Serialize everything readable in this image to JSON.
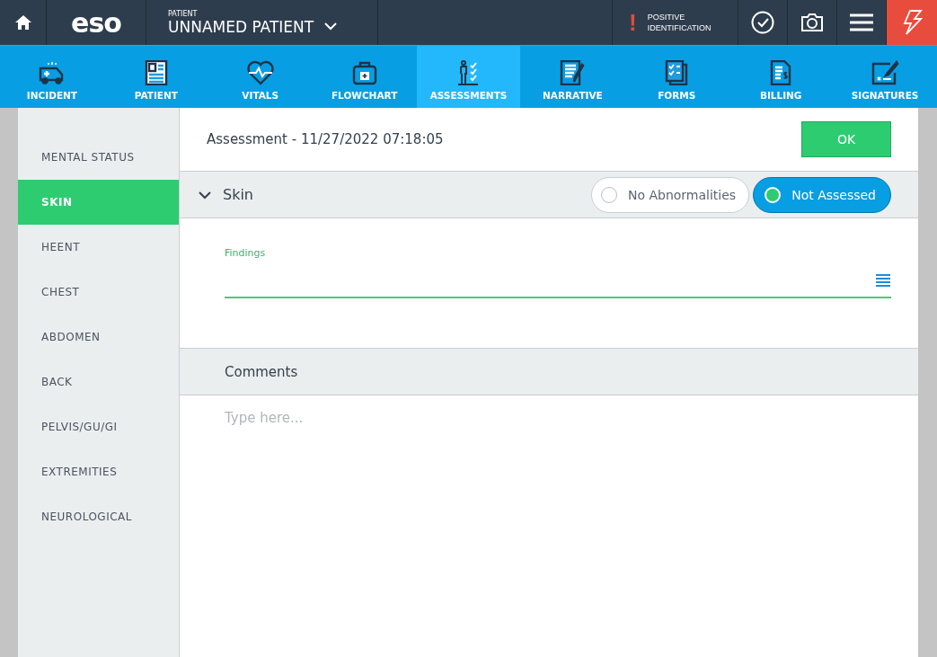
{
  "top_bar": {
    "logo": "eso",
    "patient_label": "PATIENT",
    "patient_name": "UNNAMED PATIENT",
    "alert_mark": "!",
    "alert_text": "POSITIVE IDENTIFICATION"
  },
  "tabs": [
    {
      "label": "INCIDENT",
      "selected": false
    },
    {
      "label": "PATIENT",
      "selected": false
    },
    {
      "label": "VITALS",
      "selected": false
    },
    {
      "label": "FLOWCHART",
      "selected": false
    },
    {
      "label": "ASSESSMENTS",
      "selected": true
    },
    {
      "label": "NARRATIVE",
      "selected": false
    },
    {
      "label": "FORMS",
      "selected": false
    },
    {
      "label": "BILLING",
      "selected": false
    },
    {
      "label": "SIGNATURES",
      "selected": false
    }
  ],
  "sidebar": {
    "items": [
      {
        "label": "MENTAL STATUS",
        "selected": false
      },
      {
        "label": "SKIN",
        "selected": true
      },
      {
        "label": "HEENT",
        "selected": false
      },
      {
        "label": "CHEST",
        "selected": false
      },
      {
        "label": "ABDOMEN",
        "selected": false
      },
      {
        "label": "BACK",
        "selected": false
      },
      {
        "label": "PELVIS/GU/GI",
        "selected": false
      },
      {
        "label": "EXTREMITIES",
        "selected": false
      },
      {
        "label": "NEUROLOGICAL",
        "selected": false
      }
    ]
  },
  "header": {
    "title": "Assessment - 11/27/2022 07:18:05",
    "ok_button": "OK"
  },
  "section": {
    "title": "Skin",
    "expanded": true,
    "options": [
      {
        "label": "No Abnormalities",
        "selected": false
      },
      {
        "label": "Not Assessed",
        "selected": true
      }
    ]
  },
  "findings": {
    "label": "Findings"
  },
  "comments": {
    "title": "Comments",
    "placeholder": "Type here..."
  }
}
